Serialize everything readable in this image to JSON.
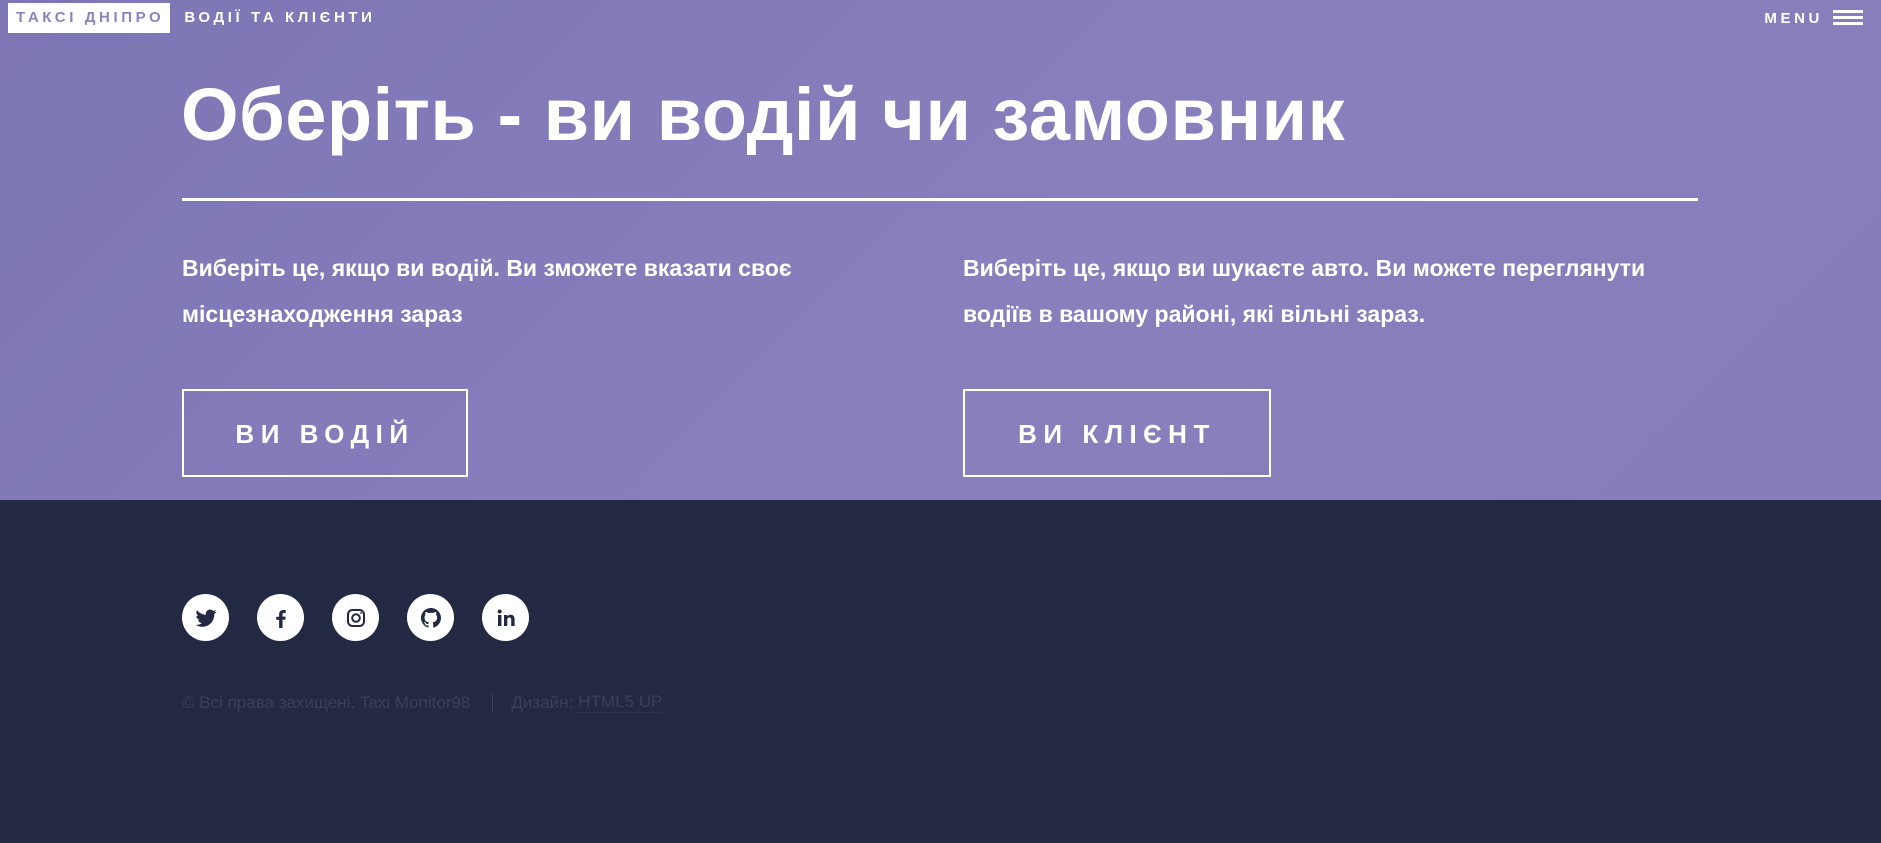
{
  "header": {
    "logo_primary": "ТАКСІ ДНІПРО",
    "logo_secondary": "ВОДІЇ ТА КЛІЄНТИ",
    "menu_label": "MENU"
  },
  "main": {
    "title": "Оберіть - ви водій чи замовник",
    "driver": {
      "description": "Виберіть це, якщо ви водій. Ви зможете вказати своє місцезнаходження зараз",
      "button_label": "ВИ ВОДІЙ"
    },
    "client": {
      "description": "Виберіть це, якщо ви шукаєте авто. Ви можете переглянути водіїв в вашому районі, які вільні зараз.",
      "button_label": "ВИ КЛІЄНТ"
    }
  },
  "footer": {
    "socials": [
      "twitter-icon",
      "facebook-icon",
      "instagram-icon",
      "github-icon",
      "linkedin-icon"
    ],
    "copyright": "© Всі права захищені. Taxi Monitor98",
    "design_label": "Дизайн:",
    "design_link": "HTML5 UP"
  },
  "colors": {
    "hero_bg": "#857ebb",
    "footer_bg": "#242943",
    "text": "#ffffff",
    "muted_text": "#3a3f5c"
  }
}
